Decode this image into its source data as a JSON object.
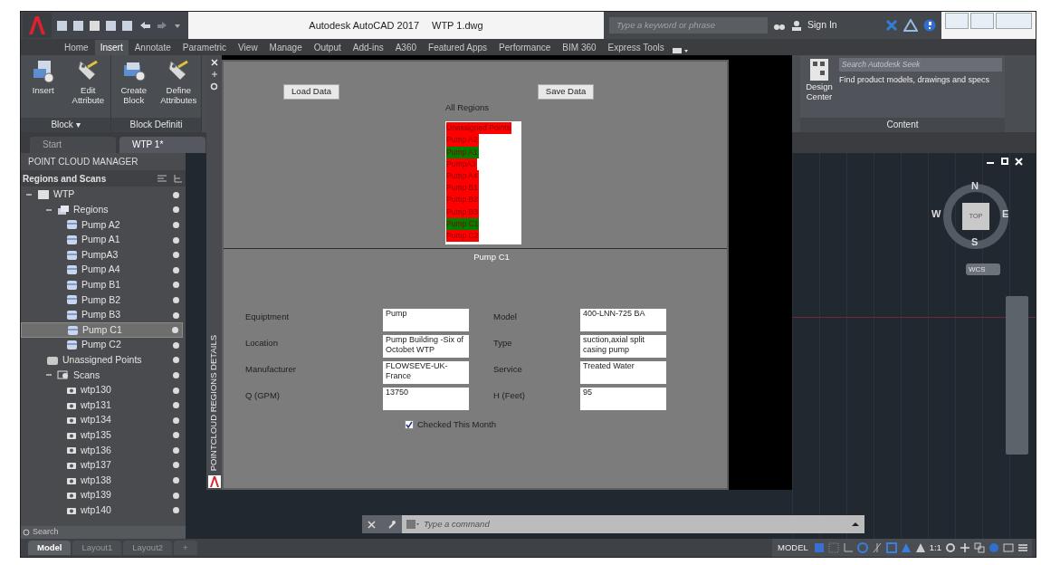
{
  "window": {
    "app_title": "Autodesk AutoCAD 2017",
    "file_name": "WTP 1.dwg",
    "search": {
      "placeholder": "Type a keyword or phrase"
    },
    "sign_in": "Sign In"
  },
  "ribbon_tabs": [
    {
      "label": "Home",
      "selected": false
    },
    {
      "label": "Insert",
      "selected": true
    },
    {
      "label": "Annotate",
      "selected": false
    },
    {
      "label": "Parametric",
      "selected": false
    },
    {
      "label": "View",
      "selected": false
    },
    {
      "label": "Manage",
      "selected": false
    },
    {
      "label": "Output",
      "selected": false
    },
    {
      "label": "Add-ins",
      "selected": false
    },
    {
      "label": "A360",
      "selected": false
    },
    {
      "label": "Featured Apps",
      "selected": false
    },
    {
      "label": "Performance",
      "selected": false
    },
    {
      "label": "BIM 360",
      "selected": false
    },
    {
      "label": "Express Tools",
      "selected": false
    }
  ],
  "ribbon_panels": [
    {
      "title": "Block ▾",
      "tools": [
        {
          "kind": "insert",
          "label": "Insert"
        },
        {
          "kind": "tag",
          "label": "Edit Attribute"
        }
      ]
    },
    {
      "title": "Block Definiti",
      "tools": [
        {
          "kind": "create",
          "label": "Create Block"
        },
        {
          "kind": "tag",
          "label": "Define Attributes"
        }
      ]
    }
  ],
  "content_panel": {
    "search": {
      "placeholder": "Search Autodesk Seek"
    },
    "tool": "Design Center",
    "description": "Find product models, drawings and specs",
    "title": "Content"
  },
  "doc_tabs": [
    {
      "label": "Start",
      "selected": false
    },
    {
      "label": "WTP 1*",
      "selected": true
    }
  ],
  "point_cloud_manager": {
    "title": "POINT CLOUD MANAGER",
    "subtitle": "Regions and Scans",
    "search": {
      "placeholder": "Search"
    },
    "tree": [
      {
        "kind": "drawing",
        "label": "WTP",
        "selected": false,
        "children": [
          {
            "kind": "regions",
            "label": "Regions",
            "selected": false,
            "children": [
              {
                "kind": "region",
                "label": "Pump A2",
                "selected": false
              },
              {
                "kind": "region",
                "label": "Pump A1",
                "selected": false
              },
              {
                "kind": "region",
                "label": "PumpA3",
                "selected": false
              },
              {
                "kind": "region",
                "label": "Pump A4",
                "selected": false
              },
              {
                "kind": "region",
                "label": "Pump B1",
                "selected": false
              },
              {
                "kind": "region",
                "label": "Pump B2",
                "selected": false
              },
              {
                "kind": "region",
                "label": "Pump B3",
                "selected": false
              },
              {
                "kind": "region",
                "label": "Pump C1",
                "selected": true
              },
              {
                "kind": "region",
                "label": "Pump C2",
                "selected": false
              }
            ]
          },
          {
            "kind": "points",
            "label": "Unassigned Points",
            "selected": false
          },
          {
            "kind": "scans",
            "label": "Scans",
            "selected": false,
            "children": [
              {
                "kind": "scan",
                "label": "wtp130",
                "selected": false
              },
              {
                "kind": "scan",
                "label": "wtp131",
                "selected": false
              },
              {
                "kind": "scan",
                "label": "wtp134",
                "selected": false
              },
              {
                "kind": "scan",
                "label": "wtp135",
                "selected": false
              },
              {
                "kind": "scan",
                "label": "wtp136",
                "selected": false
              },
              {
                "kind": "scan",
                "label": "wtp137",
                "selected": false
              },
              {
                "kind": "scan",
                "label": "wtp138",
                "selected": false
              },
              {
                "kind": "scan",
                "label": "wtp139",
                "selected": false
              },
              {
                "kind": "scan",
                "label": "wtp140",
                "selected": false
              }
            ]
          }
        ]
      }
    ]
  },
  "details_palette": {
    "side_title": "POINTCLOUD REGIONS DETAILS",
    "load_button": "Load Data",
    "save_button": "Save Data",
    "list_label": "All Regions",
    "regions": [
      {
        "label": "Unassigned Points",
        "color": "#ff0000"
      },
      {
        "label": "Pump A2",
        "color": "#ff0000"
      },
      {
        "label": "Pump A1",
        "color": "#008000"
      },
      {
        "label": "PumpA3",
        "color": "#ff0000"
      },
      {
        "label": "Pump A4",
        "color": "#ff0000"
      },
      {
        "label": "Pump B1",
        "color": "#ff0000"
      },
      {
        "label": "Pump B2",
        "color": "#ff0000"
      },
      {
        "label": "Pump B3",
        "color": "#ff0000"
      },
      {
        "label": "Pump C1",
        "color": "#008000"
      },
      {
        "label": "Pump C2",
        "color": "#ff0000"
      }
    ],
    "selected_region": "Pump C1",
    "fields": [
      {
        "label": "Equiptment",
        "value": "Pump"
      },
      {
        "label": "Model",
        "value": "400-LNN-725 BA"
      },
      {
        "label": "Location",
        "value": "Pump Building -Six of Octobet WTP"
      },
      {
        "label": "Type",
        "value": "suction,axial split casing pump"
      },
      {
        "label": "Manufacturer",
        "value": "FLOWSEVE-UK-France"
      },
      {
        "label": "Service",
        "value": "Treated Water"
      },
      {
        "label": "Q (GPM)",
        "value": "13750"
      },
      {
        "label": "H (Feet)",
        "value": "95"
      }
    ],
    "checkbox": {
      "label": "Checked This Month",
      "checked": true
    }
  },
  "viewcube": {
    "north": "N",
    "south": "S",
    "east": "E",
    "west": "W",
    "face": "TOP",
    "ucs": "WCS"
  },
  "command_line": {
    "placeholder": "Type a command"
  },
  "layout_tabs": [
    {
      "label": "Model",
      "selected": true
    },
    {
      "label": "Layout1",
      "selected": false
    },
    {
      "label": "Layout2",
      "selected": false
    },
    {
      "label": "+",
      "selected": false
    }
  ],
  "status_bar": {
    "space": "MODEL",
    "scale": "1:1"
  }
}
